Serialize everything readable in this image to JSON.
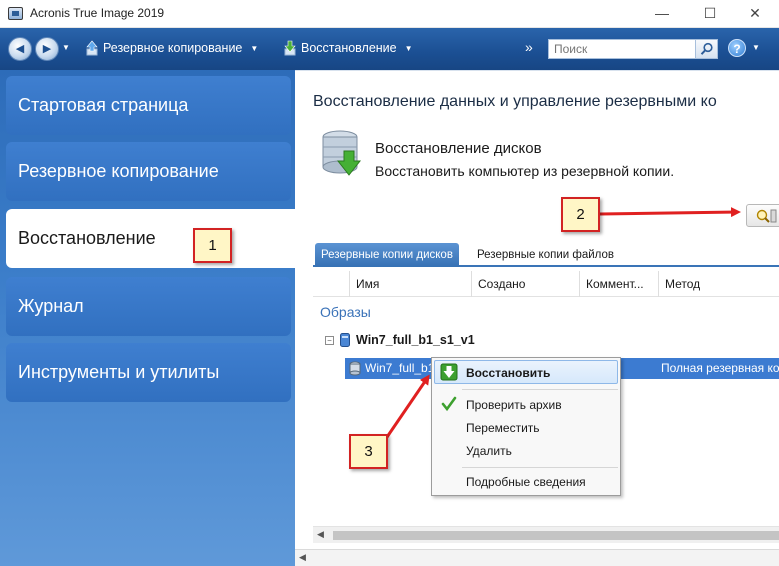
{
  "window": {
    "title": "Acronis True Image 2019",
    "minimize_glyph": "—",
    "maximize_glyph": "☐",
    "close_glyph": "✕"
  },
  "toolbar": {
    "back_glyph": "◀",
    "forward_glyph": "▶",
    "backup_label": "Резервное копирование",
    "restore_label": "Восстановление",
    "more_glyph": "»",
    "search_placeholder": "Поиск",
    "help_glyph": "?"
  },
  "sidebar": {
    "items": [
      {
        "label": "Стартовая страница"
      },
      {
        "label": "Резервное копирование"
      },
      {
        "label": "Восстановление",
        "active": true
      },
      {
        "label": "Журнал"
      },
      {
        "label": "Инструменты и утилиты"
      }
    ]
  },
  "main": {
    "title": "Восстановление данных и управление резервными ко",
    "section_title": "Восстановление дисков",
    "section_desc": "Восстановить компьютер из резервной копии.",
    "tabs": [
      {
        "label": "Резервные копии дисков",
        "active": true
      },
      {
        "label": "Резервные копии файлов"
      }
    ],
    "columns": [
      "Имя",
      "Создано",
      "Коммент...",
      "Метод"
    ],
    "group_label": "Образы",
    "expand_glyph": "−",
    "archive_name": "Win7_full_b1_s1_v1",
    "backup_name": "Win7_full_b1",
    "backup_method": "Полная резервная ко",
    "scroll_left_glyph": "◀"
  },
  "context_menu": {
    "items": [
      "Восстановить",
      "Проверить архив",
      "Переместить",
      "Удалить",
      "Подробные сведения"
    ]
  },
  "callouts": [
    "1",
    "2",
    "3"
  ],
  "colors": {
    "toolbar": "#1b4f93",
    "sidebar": "#3b7dc9",
    "selection": "#3c7bd1",
    "callout_border": "#d22323",
    "callout_fill": "#fff6c6",
    "arrow": "#e02020"
  }
}
